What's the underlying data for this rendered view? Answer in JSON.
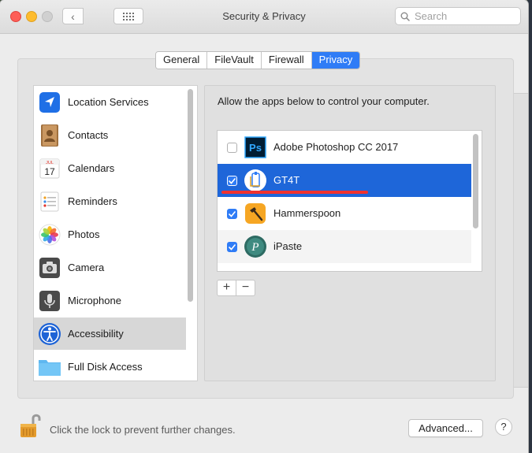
{
  "window": {
    "title": "Security & Privacy",
    "back_glyph": "‹",
    "forward_glyph": "›"
  },
  "search": {
    "placeholder": "Search"
  },
  "tabs": [
    {
      "label": "General"
    },
    {
      "label": "FileVault"
    },
    {
      "label": "Firewall"
    },
    {
      "label": "Privacy",
      "active": true
    }
  ],
  "sidebar": {
    "items": [
      {
        "label": "Location Services",
        "icon": "location-arrow-icon"
      },
      {
        "label": "Contacts",
        "icon": "contacts-book-icon"
      },
      {
        "label": "Calendars",
        "icon": "calendar-icon",
        "month": "JUL",
        "day": "17"
      },
      {
        "label": "Reminders",
        "icon": "reminders-list-icon"
      },
      {
        "label": "Photos",
        "icon": "photos-flower-icon"
      },
      {
        "label": "Camera",
        "icon": "camera-icon"
      },
      {
        "label": "Microphone",
        "icon": "microphone-icon"
      },
      {
        "label": "Accessibility",
        "icon": "accessibility-icon",
        "selected": true
      },
      {
        "label": "Full Disk Access",
        "icon": "folder-icon"
      }
    ]
  },
  "privacy": {
    "instruction": "Allow the apps below to control your computer.",
    "apps": [
      {
        "name": "Adobe Photoshop CC 2017",
        "checked": false,
        "icon": "photoshop-icon",
        "icon_text": "Ps"
      },
      {
        "name": "GT4T",
        "checked": true,
        "icon": "gt4t-icon",
        "selected": true
      },
      {
        "name": "Hammerspoon",
        "checked": true,
        "icon": "hammerspoon-icon"
      },
      {
        "name": "iPaste",
        "checked": true,
        "icon": "ipaste-icon",
        "icon_text": "P"
      }
    ],
    "add_label": "+",
    "remove_label": "−"
  },
  "footer": {
    "lock_text": "Click the lock to prevent further changes.",
    "advanced_label": "Advanced...",
    "help_label": "?"
  },
  "colors": {
    "accent": "#2f7cf6",
    "selection": "#1e66d9",
    "annotation_underline": "#f0322f"
  }
}
